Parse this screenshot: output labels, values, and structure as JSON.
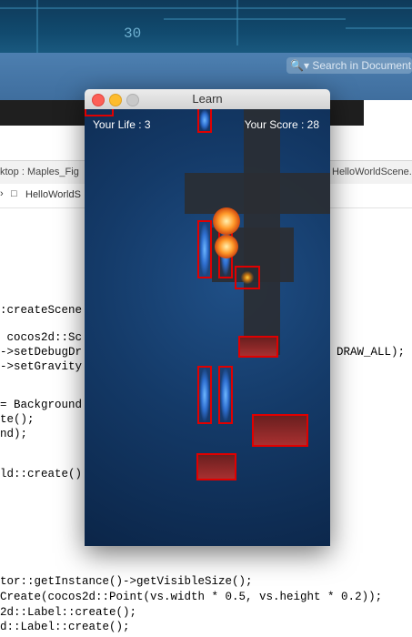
{
  "wallpaper": {
    "number": "30"
  },
  "search": {
    "placeholder": "Search in Document"
  },
  "pathbar": {
    "text": "ktop : Maples_Fig",
    "file": "HelloWorldScene.cpp",
    "breadcrumb": "HelloWorldS"
  },
  "code_lines": [
    ":createScene",
    " cocos2d::Sc",
    "->setDebugDr",
    "->setGravity",
    "= Background",
    "te();",
    "nd);",
    "ld::create()",
    "tor::getInstance()->getVisibleSize();",
    "Create(cocos2d::Point(vs.width * 0.5, vs.height * 0.2));",
    "2d::Label::create();",
    "d::Label::create();"
  ],
  "code_right": "DRAW_ALL);",
  "window": {
    "title": "Learn"
  },
  "hud": {
    "life": "Your Life : 3",
    "score": "Your Score : 28"
  },
  "colors": {
    "hitbox": "#e00000",
    "space": "#143a68"
  }
}
